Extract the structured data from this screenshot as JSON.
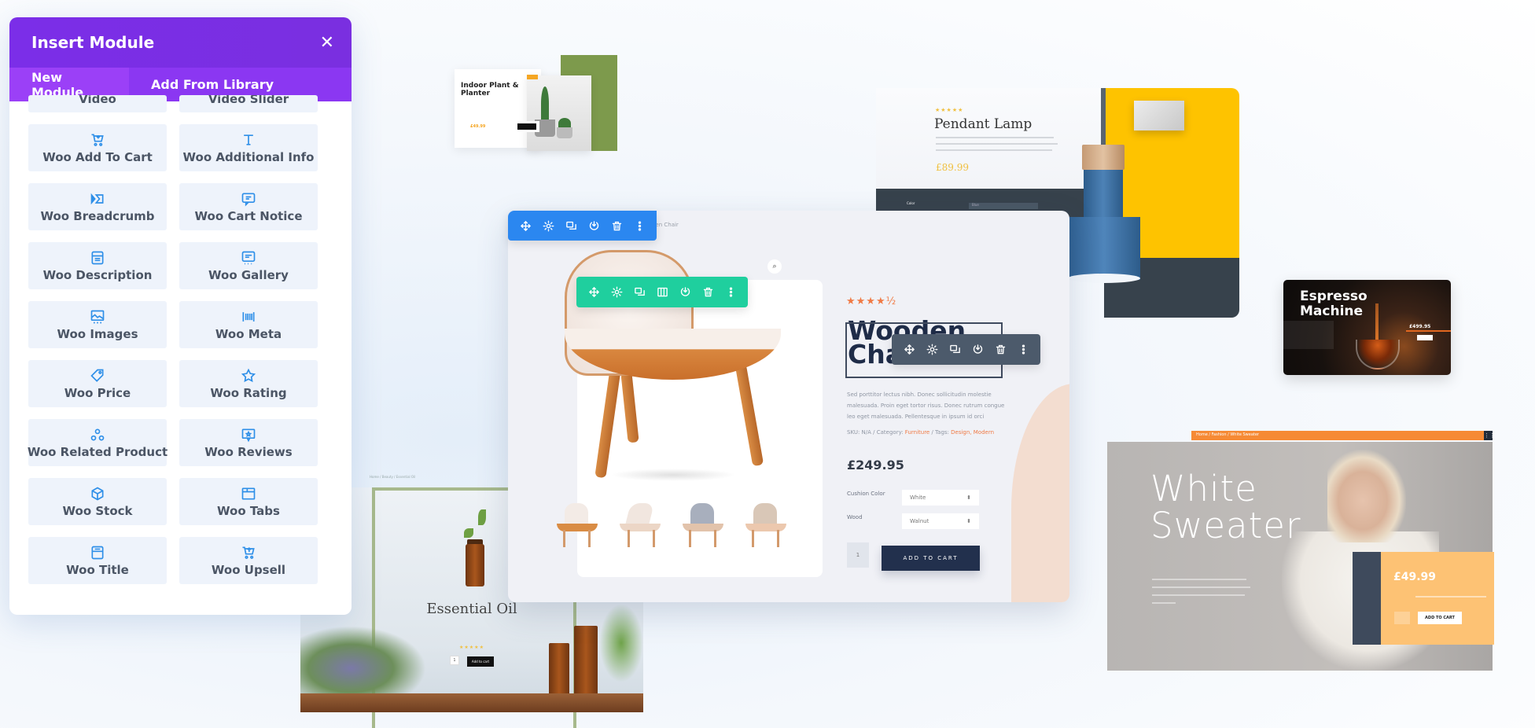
{
  "panel": {
    "title": "Insert Module",
    "close_icon": "close-icon",
    "tabs": [
      {
        "label": "New Module",
        "active": true
      },
      {
        "label": "Add From Library",
        "active": false
      }
    ],
    "modules": [
      {
        "label": "Video",
        "icon": "video-icon"
      },
      {
        "label": "Video Slider",
        "icon": "video-slider-icon"
      },
      {
        "label": "Woo Add To Cart",
        "icon": "cart-add-icon"
      },
      {
        "label": "Woo Additional Info",
        "icon": "text-icon"
      },
      {
        "label": "Woo Breadcrumb",
        "icon": "breadcrumb-icon"
      },
      {
        "label": "Woo Cart Notice",
        "icon": "message-icon"
      },
      {
        "label": "Woo Description",
        "icon": "description-icon"
      },
      {
        "label": "Woo Gallery",
        "icon": "gallery-icon"
      },
      {
        "label": "Woo Images",
        "icon": "image-icon"
      },
      {
        "label": "Woo Meta",
        "icon": "barcode-icon"
      },
      {
        "label": "Woo Price",
        "icon": "tag-icon"
      },
      {
        "label": "Woo Rating",
        "icon": "star-icon"
      },
      {
        "label": "Woo Related Product",
        "icon": "related-icon"
      },
      {
        "label": "Woo Reviews",
        "icon": "review-icon"
      },
      {
        "label": "Woo Stock",
        "icon": "box-icon"
      },
      {
        "label": "Woo Tabs",
        "icon": "tabs-icon"
      },
      {
        "label": "Woo Title",
        "icon": "title-icon"
      },
      {
        "label": "Woo Upsell",
        "icon": "cart-upsell-icon"
      }
    ]
  },
  "toolbars": {
    "section": [
      "move-icon",
      "settings-icon",
      "duplicate-icon",
      "save-icon",
      "delete-icon",
      "more-icon"
    ],
    "row": [
      "move-icon",
      "settings-icon",
      "duplicate-icon",
      "columns-icon",
      "save-icon",
      "delete-icon",
      "more-icon"
    ],
    "module": [
      "move-icon",
      "settings-icon",
      "duplicate-icon",
      "save-icon",
      "delete-icon",
      "more-icon"
    ],
    "colors": {
      "section": "#2b87f0",
      "row": "#1fcf9e",
      "module": "#4c5a6b"
    }
  },
  "main_product": {
    "breadcrumb": "...oden Chair",
    "rating_stars": "★★★★½",
    "rating": 4.5,
    "title_line1": "Wooden",
    "title_line2": "Chair",
    "description": [
      "Sed porttitor lectus nibh. Donec sollicitudin molestie",
      "malesuada. Proin eget tortor risus. Donec rutrum congue",
      "leo eget malesuada. Pellentesque in ipsum id orci"
    ],
    "meta": {
      "sku_label": "SKU: N/A / Category: ",
      "category": "Furniture",
      "tags_label": " / Tags: ",
      "tags": "Design, Modern"
    },
    "price": "£249.95",
    "options": [
      {
        "label": "Cushion Color",
        "value": "White"
      },
      {
        "label": "Wood",
        "value": "Walnut"
      }
    ],
    "quantity": "1",
    "add_to_cart": "ADD TO CART",
    "accent": "#f07a45"
  },
  "plant_card": {
    "title": "Indoor Plant & Planter",
    "price": "£49.99",
    "accent": "#7d9a4c"
  },
  "lamp_card": {
    "stars": "★★★★★",
    "title": "Pendant Lamp",
    "price": "£89.99",
    "color_label": "Color",
    "color_value": "Blue",
    "accent": "#fec300"
  },
  "espresso_card": {
    "title_line1": "Espresso",
    "title_line2": "Machine",
    "price": "£499.95"
  },
  "sweater_card": {
    "breadcrumb": "Home / Fashion / White Sweater",
    "title_line1": "White",
    "title_line2": "Sweater",
    "price": "£49.99",
    "add_to_cart": "ADD TO CART",
    "accent": "#f68a34"
  },
  "oil_card": {
    "breadcrumb": "Home / Beauty / Essential Oil",
    "title": "Essential Oil",
    "stars": "★★★★★",
    "quantity": "1",
    "add_to_cart": "Add to cart"
  }
}
